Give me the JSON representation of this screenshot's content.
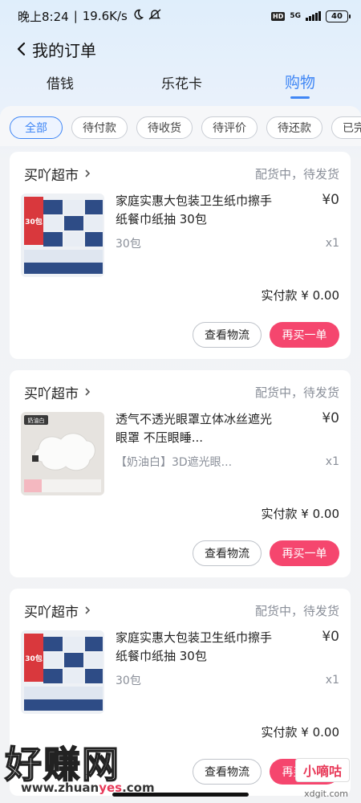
{
  "status_bar": {
    "time": "晚上8:24",
    "speed": "19.6K/s",
    "hd": "HD",
    "net_type": "5G",
    "battery": "40"
  },
  "header": {
    "title": "我的订单"
  },
  "top_tabs": [
    "借钱",
    "乐花卡",
    "购物"
  ],
  "filters": [
    "全部",
    "待付款",
    "待收货",
    "待评价",
    "待还款",
    "已完成"
  ],
  "orders": [
    {
      "store": "买吖超市",
      "status": "配货中，待发货",
      "title": "家庭实惠大包装卫生纸巾擦手纸餐巾纸抽 30包",
      "price": "¥0",
      "spec": "30包",
      "qty": "x1",
      "paid": "实付款 ¥ 0.00",
      "btn_logistics": "查看物流",
      "btn_rebuy": "再买一单",
      "thumb_tag": "30包"
    },
    {
      "store": "买吖超市",
      "status": "配货中，待发货",
      "title": "透气不透光眼罩立体冰丝遮光眼罩 不压眼睡...",
      "price": "¥0",
      "spec": "【奶油白】3D遮光眼...",
      "qty": "x1",
      "paid": "实付款 ¥ 0.00",
      "btn_logistics": "查看物流",
      "btn_rebuy": "再买一单",
      "thumb_tag": "奶油白"
    },
    {
      "store": "买吖超市",
      "status": "配货中，待发货",
      "title": "家庭实惠大包装卫生纸巾擦手纸餐巾纸抽 30包",
      "price": "¥0",
      "spec": "30包",
      "qty": "x1",
      "paid": "实付款 ¥ 0.00",
      "btn_logistics": "查看物流",
      "btn_rebuy": "再买一单",
      "thumb_tag": "30包"
    }
  ],
  "watermark": {
    "big": "好赚网",
    "url_a": "www.zhuan",
    "url_b": "yes",
    "url_c": ".com",
    "box": "小嘀咕",
    "small": "xdgit.com"
  },
  "colors": {
    "accent": "#3f86f5",
    "rebuy": "#f5466e"
  }
}
